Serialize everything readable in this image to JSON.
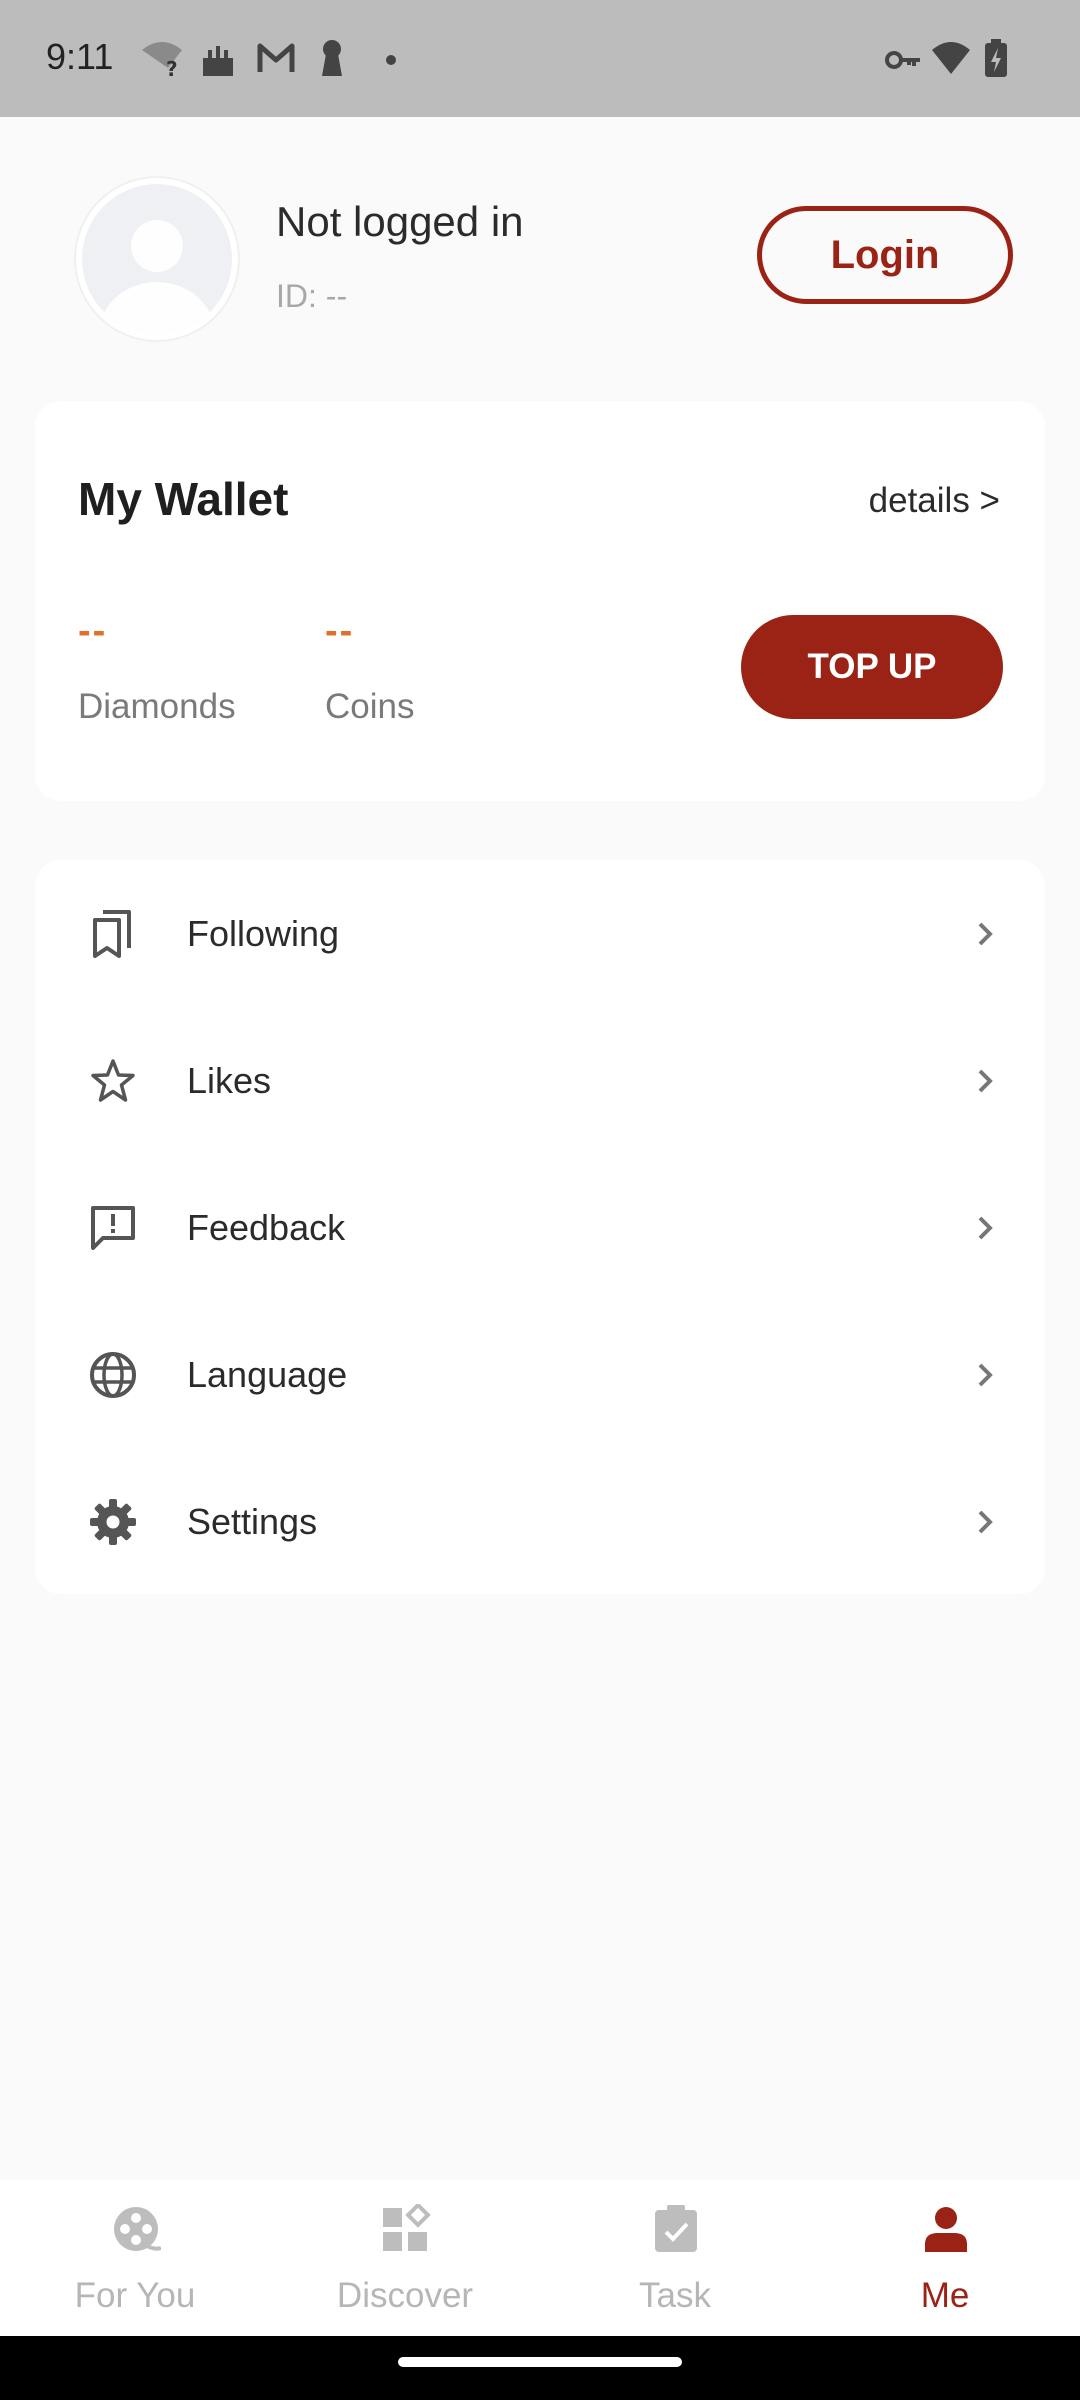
{
  "status_bar": {
    "time": "9:11",
    "background": "#bcbcbc",
    "left_icons": [
      "wifi-question-icon",
      "cake-icon",
      "gmail-icon",
      "keyhole-icon",
      "dot-icon"
    ],
    "right_icons": [
      "key-icon",
      "wifi-icon",
      "battery-charging-icon"
    ]
  },
  "profile": {
    "name": "Not logged in",
    "id": "ID: --",
    "login_label": "Login"
  },
  "wallet": {
    "title": "My Wallet",
    "details_label": "details >",
    "diamonds_value": "--",
    "diamonds_label": "Diamonds",
    "coins_value": "--",
    "coins_label": "Coins",
    "topup_label": "TOP UP"
  },
  "menu": {
    "items": [
      {
        "label": "Following",
        "icon": "bookmarks-icon"
      },
      {
        "label": "Likes",
        "icon": "star-icon"
      },
      {
        "label": "Feedback",
        "icon": "feedback-icon"
      },
      {
        "label": "Language",
        "icon": "globe-icon"
      },
      {
        "label": "Settings",
        "icon": "gear-icon"
      }
    ]
  },
  "bottom_nav": {
    "items": [
      {
        "label": "For You",
        "icon": "film-reel-icon",
        "active": false
      },
      {
        "label": "Discover",
        "icon": "apps-icon",
        "active": false
      },
      {
        "label": "Task",
        "icon": "clipboard-check-icon",
        "active": false
      },
      {
        "label": "Me",
        "icon": "person-icon",
        "active": true
      }
    ]
  },
  "colors": {
    "brand": "#9b2316",
    "accent_orange": "#e0712a",
    "inactive_nav": "#b6b6b6",
    "page_bg": "#fafafa"
  }
}
